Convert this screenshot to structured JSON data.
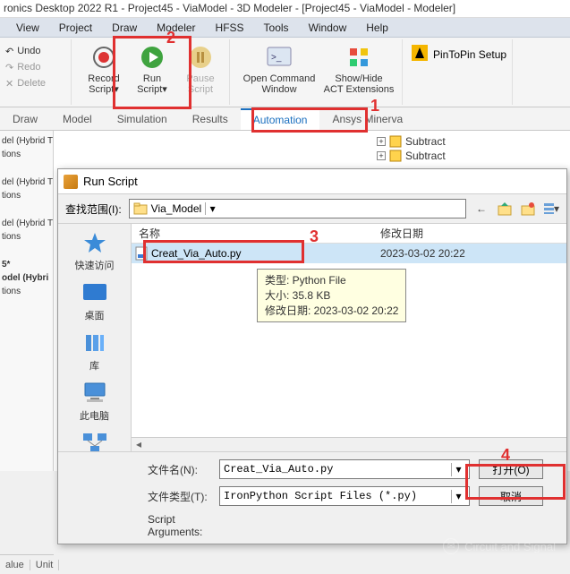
{
  "title": "ronics Desktop 2022 R1 - Project45 - ViaModel - 3D Modeler - [Project45 - ViaModel - Modeler]",
  "menu": [
    "View",
    "Project",
    "Draw",
    "Modeler",
    "HFSS",
    "Tools",
    "Window",
    "Help"
  ],
  "edit": {
    "undo": "Undo",
    "redo": "Redo",
    "delete": "Delete"
  },
  "ribbon": {
    "record": "Record\nScript▾",
    "run": "Run\nScript▾",
    "pause": "Pause\nScript",
    "openCmd": "Open Command\nWindow",
    "showHide": "Show/Hide\nACT Extensions",
    "pinToPin": "PinToPin Setup"
  },
  "tabs": [
    "Draw",
    "Model",
    "Simulation",
    "Results",
    "Automation",
    "Ansys Minerva"
  ],
  "tree": {
    "l1": "del (Hybrid T",
    "l2": "tions",
    "l3": "del (Hybrid T",
    "l4": "tions",
    "l5": "del (Hybrid T",
    "l6": "tions",
    "l7": "5*",
    "l8": "odel (Hybri",
    "l9": "tions"
  },
  "subtract": "Subtract",
  "dialog": {
    "title": "Run Script",
    "lookIn": "查找范围(I):",
    "folder": "Via_Model",
    "colName": "名称",
    "colDate": "修改日期",
    "file": "Creat_Via_Auto.py",
    "fileDate": "2023-03-02 20:22",
    "tip1": "类型: Python File",
    "tip2": "大小: 35.8 KB",
    "tip3": "修改日期: 2023-03-02 20:22",
    "places": {
      "quick": "快速访问",
      "desktop": "桌面",
      "lib": "库",
      "pc": "此电脑",
      "net": "网络"
    },
    "fileNameLabel": "文件名(N):",
    "fileName": "Creat_Via_Auto.py",
    "fileTypeLabel": "文件类型(T):",
    "fileType": "IronPython Script Files (*.py)",
    "open": "打开(O)",
    "cancel": "取消",
    "scriptArgs": "Script\nArguments:"
  },
  "annotations": {
    "n1": "1",
    "n2": "2",
    "n3": "3",
    "n4": "4"
  },
  "watermark": "Circuit and Signal",
  "status": {
    "value": "alue",
    "unit": "Unit"
  }
}
